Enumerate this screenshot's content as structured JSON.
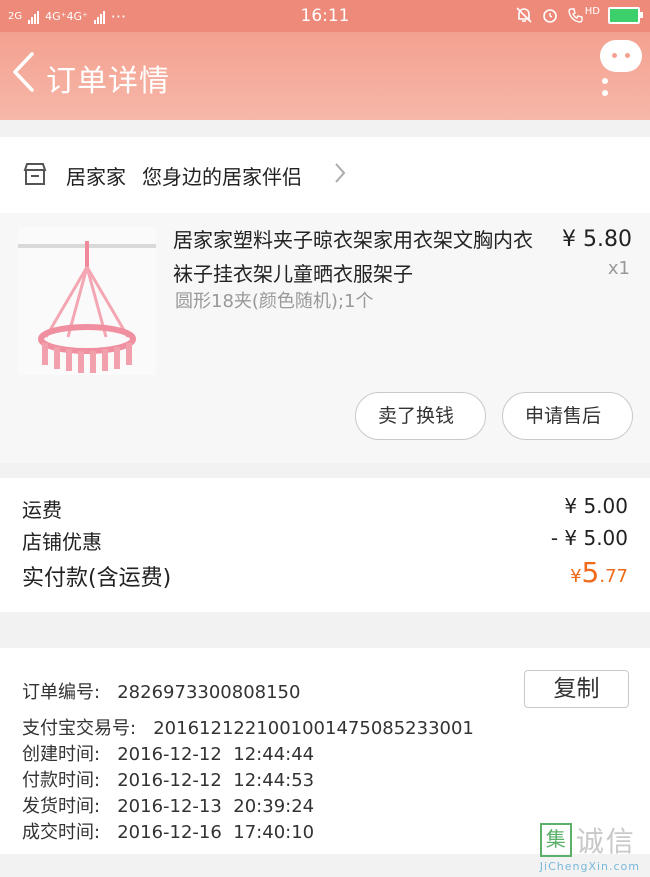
{
  "status_bar": {
    "net_left": "2G",
    "net_mid": "4G⁺4G⁺",
    "more": "···",
    "time": "16:11",
    "hd": "HD"
  },
  "header": {
    "title": "订单详情"
  },
  "shop": {
    "name": "居家家",
    "slogan": "您身边的居家伴侣"
  },
  "item": {
    "name": "居家家塑料夹子晾衣架家用衣架文胸内衣袜子挂衣架儿童晒衣服架子",
    "spec": "圆形18夹(颜色随机);1个",
    "price": "¥ 5.80",
    "qty": "x1",
    "btn_sell": "卖了换钱",
    "btn_service": "申请售后"
  },
  "fees": {
    "shipping_label": "运费",
    "shipping_value": "¥ 5.00",
    "discount_label": "店铺优惠",
    "discount_value": "- ¥ 5.00",
    "paid_label": "实付款(含运费)",
    "paid_currency": "¥",
    "paid_int": "5",
    "paid_dec": ".77"
  },
  "info": {
    "order_no": "订单编号:   2826973300808150",
    "copy_label": "复制",
    "alipay_no": "支付宝交易号:   2016121221001001475085233001",
    "created": "创建时间:   2016-12-12  12:44:44",
    "paid": "付款时间:   2016-12-12  12:44:53",
    "shipped": "发货时间:   2016-12-13  20:39:24",
    "done": "成交时间:   2016-12-16  17:40:10"
  },
  "watermark": {
    "box": "集",
    "text": "诚信",
    "url": "JiChengXin.com"
  },
  "colors": {
    "header": "#f4a18f",
    "accent_price": "#f06a1a"
  }
}
